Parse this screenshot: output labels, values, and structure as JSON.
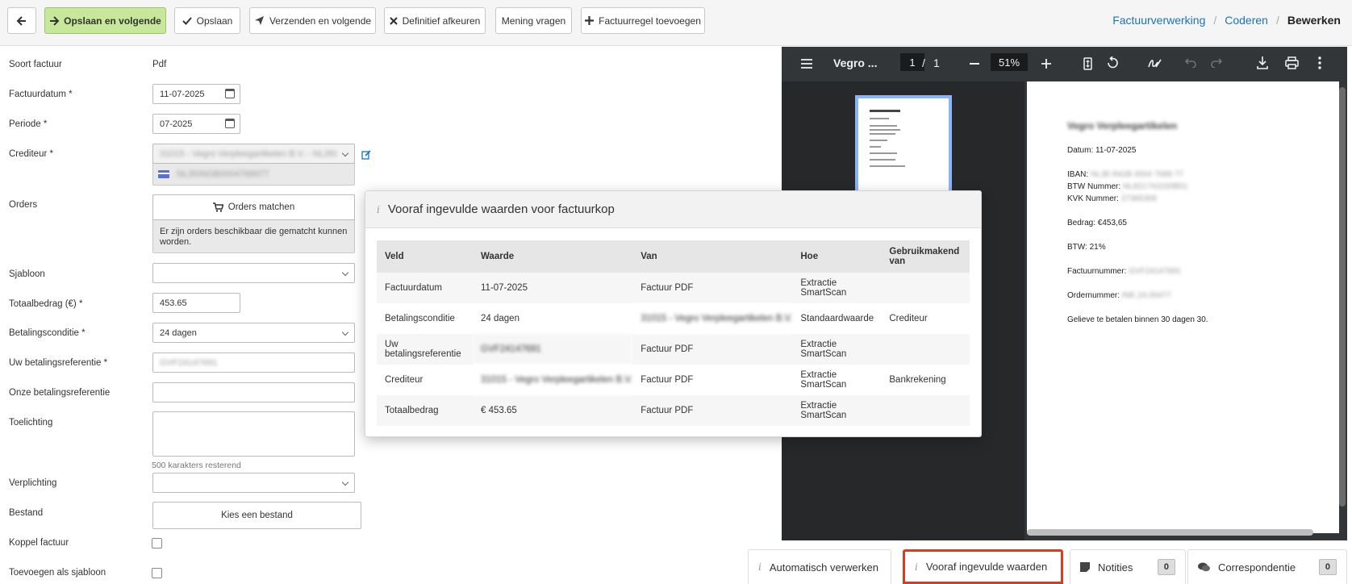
{
  "toolbar": {
    "back_icon": "arrow-left-icon",
    "save_next": "Opslaan en volgende",
    "save": "Opslaan",
    "send_next": "Verzenden en volgende",
    "reject": "Definitief afkeuren",
    "opinion": "Mening vragen",
    "add_line": "Factuurregel toevoegen"
  },
  "breadcrumb": {
    "items": [
      "Factuurverwerking",
      "Coderen"
    ],
    "current": "Bewerken"
  },
  "form": {
    "type_label": "Soort factuur",
    "type_value": "Pdf",
    "date_label": "Factuurdatum *",
    "date_value": "11-07-2025",
    "period_label": "Periode *",
    "period_value": "07-2025",
    "creditor_label": "Crediteur *",
    "creditor_value": "31015 - Vegro Verpleegartikelen B.V. - NL35I",
    "iban_value": "NL35INGB0004768977",
    "orders_label": "Orders",
    "orders_button": "Orders matchen",
    "orders_note": "Er zijn orders beschikbaar die gematcht kunnen worden.",
    "template_label": "Sjabloon",
    "total_label": "Totaalbedrag (€) *",
    "total_value": "453.65",
    "terms_label": "Betalingsconditie *",
    "terms_value": "24 dagen",
    "your_ref_label": "Uw betalingsreferentie *",
    "your_ref_value": "GVF24147691",
    "our_ref_label": "Onze betalingsreferentie",
    "note_label": "Toelichting",
    "chars_left": "500 karakters resterend",
    "obligation_label": "Verplichting",
    "file_label": "Bestand",
    "file_button": "Kies een bestand",
    "link_label": "Koppel factuur",
    "as_template_label": "Toevoegen als sjabloon"
  },
  "viewer": {
    "title": "Vegro ...",
    "page": "1",
    "page_sep": "/",
    "pages": "1",
    "zoom": "51%",
    "doc": {
      "heading": "Vegro Verpleegartikelen",
      "date": "Datum: 11-07-2025",
      "iban_l": "IBAN:",
      "iban_v": "NL35 INGB 0004 7689 77",
      "btw_l": "BTW Nummer:",
      "btw_v": "NL821741020B01",
      "kvk_l": "KVK Nummer:",
      "kvk_v": "27365306",
      "amount": "Bedrag: €453,65",
      "vat": "BTW: 21%",
      "inv_l": "Factuurnummer:",
      "inv_v": "GVF24147691",
      "ord_l": "Ordernummer:",
      "ord_v": "INK.24.00477",
      "pay": "Gelieve te betalen binnen 30 dagen 30."
    }
  },
  "modal": {
    "title": "Vooraf ingevulde waarden voor factuurkop",
    "headers": [
      "Veld",
      "Waarde",
      "Van",
      "Hoe",
      "Gebruikmakend van"
    ],
    "rows": [
      {
        "veld": "Factuurdatum",
        "waarde": "11-07-2025",
        "van": "Factuur PDF",
        "hoe": "Extractie SmartScan",
        "gebruik": ""
      },
      {
        "veld": "Betalingsconditie",
        "waarde": "24 dagen",
        "van": "31015 - Vegro Verpleegartikelen B.V.",
        "hoe": "Standaardwaarde",
        "gebruik": "Crediteur"
      },
      {
        "veld": "Uw betalingsreferentie",
        "waarde": "GVF24147691",
        "van": "Factuur PDF",
        "hoe": "Extractie SmartScan",
        "gebruik": ""
      },
      {
        "veld": "Crediteur",
        "waarde": "31015 - Vegro Verpleegartikelen B.V.",
        "van": "Factuur PDF",
        "hoe": "Extractie SmartScan",
        "gebruik": "Bankrekening"
      },
      {
        "veld": "Totaalbedrag",
        "waarde": "€ 453.65",
        "van": "Factuur PDF",
        "hoe": "Extractie SmartScan",
        "gebruik": ""
      }
    ]
  },
  "bottom_tabs": {
    "auto": "Automatisch verwerken",
    "prefilled": "Vooraf ingevulde waarden",
    "notes": "Notities",
    "notes_count": "0",
    "correspondence": "Correspondentie",
    "correspondence_count": "0"
  },
  "colors": {
    "primary_button": "#c7e89a",
    "link": "#1a73b8",
    "highlight": "#e03a1e"
  }
}
